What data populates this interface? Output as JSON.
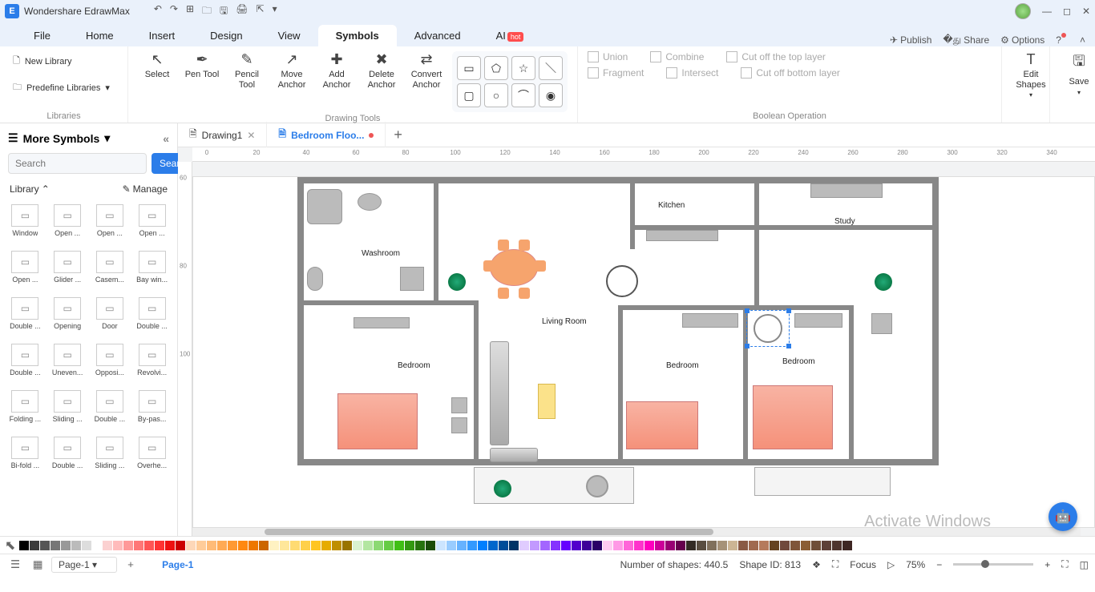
{
  "app": {
    "title": "Wondershare EdrawMax"
  },
  "menus": [
    "File",
    "Home",
    "Insert",
    "Design",
    "View",
    "Symbols",
    "Advanced",
    "AI"
  ],
  "active_menu": "Symbols",
  "right_menu": {
    "publish": "Publish",
    "share": "Share",
    "options": "Options"
  },
  "ribbon": {
    "libraries": {
      "new": "New Library",
      "predef": "Predefine Libraries",
      "label": "Libraries"
    },
    "drawing": {
      "select": "Select",
      "pen": "Pen Tool",
      "pencil": "Pencil Tool",
      "move": "Move Anchor",
      "add": "Add Anchor",
      "delete": "Delete Anchor",
      "convert": "Convert Anchor",
      "label": "Drawing Tools"
    },
    "boolean": {
      "union": "Union",
      "combine": "Combine",
      "cuttop": "Cut off the top layer",
      "fragment": "Fragment",
      "intersect": "Intersect",
      "cutbot": "Cut off bottom layer",
      "label": "Boolean Operation"
    },
    "edit": "Edit Shapes",
    "save": "Save"
  },
  "sidebar": {
    "title": "More Symbols",
    "search_placeholder": "Search",
    "search_btn": "Search",
    "library": "Library",
    "manage": "Manage",
    "items": [
      {
        "label": "Window"
      },
      {
        "label": "Open ..."
      },
      {
        "label": "Open ..."
      },
      {
        "label": "Open ..."
      },
      {
        "label": "Open ..."
      },
      {
        "label": "Glider ..."
      },
      {
        "label": "Casem..."
      },
      {
        "label": "Bay win..."
      },
      {
        "label": "Double ..."
      },
      {
        "label": "Opening"
      },
      {
        "label": "Door"
      },
      {
        "label": "Double ..."
      },
      {
        "label": "Double ..."
      },
      {
        "label": "Uneven..."
      },
      {
        "label": "Opposi..."
      },
      {
        "label": "Revolvi..."
      },
      {
        "label": "Folding ..."
      },
      {
        "label": "Sliding ..."
      },
      {
        "label": "Double ..."
      },
      {
        "label": "By-pas..."
      },
      {
        "label": "Bi-fold ..."
      },
      {
        "label": "Double ..."
      },
      {
        "label": "Sliding ..."
      },
      {
        "label": "Overhe..."
      }
    ]
  },
  "tabs": [
    {
      "label": "Drawing1",
      "active": false,
      "dirty": false
    },
    {
      "label": "Bedroom Floo...",
      "active": true,
      "dirty": true
    }
  ],
  "ruler_h": [
    0,
    20,
    40,
    60,
    80,
    100,
    120,
    140,
    160,
    180,
    200,
    220,
    240,
    260,
    280,
    300,
    320,
    340
  ],
  "ruler_v": [
    60,
    80,
    100
  ],
  "rooms": {
    "washroom": "Washroom",
    "kitchen": "Kitchen",
    "study": "Study",
    "living": "Living Room",
    "bedroom": "Bedroom"
  },
  "status": {
    "page": "Page-1",
    "shapes": "Number of shapes: 440.5",
    "shapeid": "Shape ID: 813",
    "focus": "Focus",
    "zoom": "75%"
  },
  "watermark": "Activate Windows",
  "colors": [
    "#000",
    "#3b3b3b",
    "#555",
    "#777",
    "#999",
    "#bbb",
    "#ddd",
    "#fff",
    "#fbd1d1",
    "#fbb",
    "#f99",
    "#f77",
    "#f55",
    "#f33",
    "#e11",
    "#c00",
    "#fdd7b8",
    "#fc9",
    "#fb7",
    "#fa5",
    "#f93",
    "#f81",
    "#e70",
    "#c60",
    "#fff2c2",
    "#ffe79a",
    "#ffdb72",
    "#ffd04a",
    "#ffc522",
    "#e6ac00",
    "#bf8f00",
    "#997300",
    "#d9f2d0",
    "#b3e6a1",
    "#8cd973",
    "#66cc44",
    "#40bf15",
    "#339912",
    "#26730e",
    "#1a4d09",
    "#cce5ff",
    "#99ccff",
    "#66b2ff",
    "#3399ff",
    "#007fff",
    "#0066cc",
    "#004c99",
    "#003366",
    "#e0ccff",
    "#c299ff",
    "#a366ff",
    "#8533ff",
    "#6600ff",
    "#5200cc",
    "#3d0099",
    "#290066",
    "#ffccf2",
    "#ff99e6",
    "#ff66d9",
    "#ff33cc",
    "#ff00bf",
    "#cc0099",
    "#990073",
    "#66004d",
    "#332b24",
    "#594d40",
    "#80705c",
    "#a69278",
    "#ccb594",
    "#8a5a44",
    "#a06a50",
    "#b57a5c",
    "#654321",
    "#70483c",
    "#7f5539",
    "#8b5e34",
    "#6f4e37",
    "#5d4037",
    "#4e342e",
    "#3e2723"
  ]
}
